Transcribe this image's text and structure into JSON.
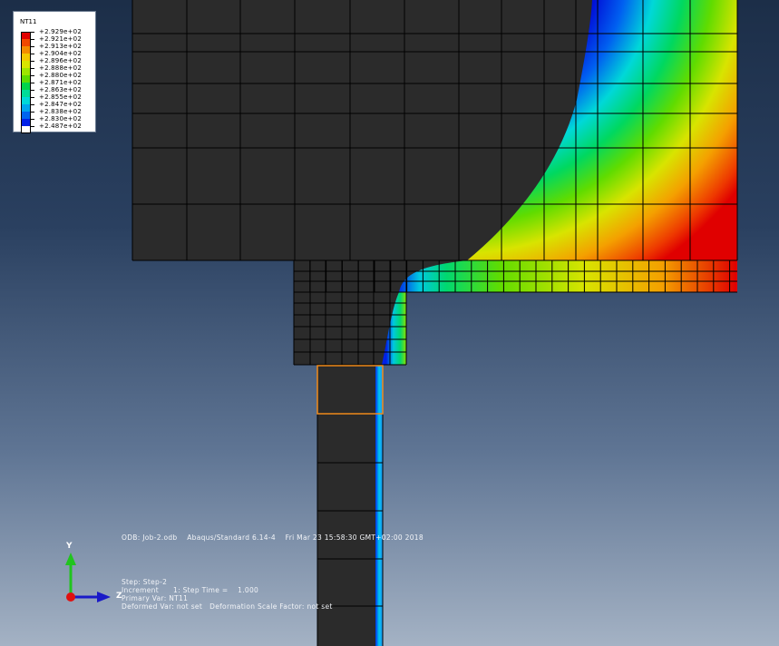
{
  "legend": {
    "title": "NT11",
    "entries": [
      {
        "label": "+2.929e+02",
        "color": "#e00000"
      },
      {
        "label": "+2.921e+02",
        "color": "#f04800"
      },
      {
        "label": "+2.913e+02",
        "color": "#f48c00"
      },
      {
        "label": "+2.904e+02",
        "color": "#f4c800"
      },
      {
        "label": "+2.896e+02",
        "color": "#d8e400"
      },
      {
        "label": "+2.888e+02",
        "color": "#9ee600"
      },
      {
        "label": "+2.880e+02",
        "color": "#5cdc00"
      },
      {
        "label": "+2.871e+02",
        "color": "#00d44a"
      },
      {
        "label": "+2.863e+02",
        "color": "#00dc98"
      },
      {
        "label": "+2.855e+02",
        "color": "#00d8d8"
      },
      {
        "label": "+2.847e+02",
        "color": "#00a6ec"
      },
      {
        "label": "+2.838e+02",
        "color": "#0064f0"
      },
      {
        "label": "+2.830e+02",
        "color": "#0020e8"
      },
      {
        "label": "+2.487e+02",
        "color": "#ffffff"
      }
    ]
  },
  "info": {
    "odb_line": "ODB: Job-2.odb    Abaqus/Standard 6.14-4    Fri Mar 23 15:58:30 GMT+02:00 2018",
    "step_line": "Step: Step-2",
    "increment_line": "Increment      1: Step Time =    1.000",
    "primary_var_line": "Primary Var: NT11",
    "deformed_var_line": "Deformed Var: not set   Deformation Scale Factor: not set"
  },
  "triad": {
    "y_label": "Y",
    "z_label": "Z",
    "y_color": "#21c41e",
    "z_color": "#1a1ac8",
    "origin_color": "#e01010"
  },
  "mesh_colors": {
    "solid": "#2b2b2b",
    "grid_line": "#000000",
    "highlight": "#f08a1a"
  }
}
